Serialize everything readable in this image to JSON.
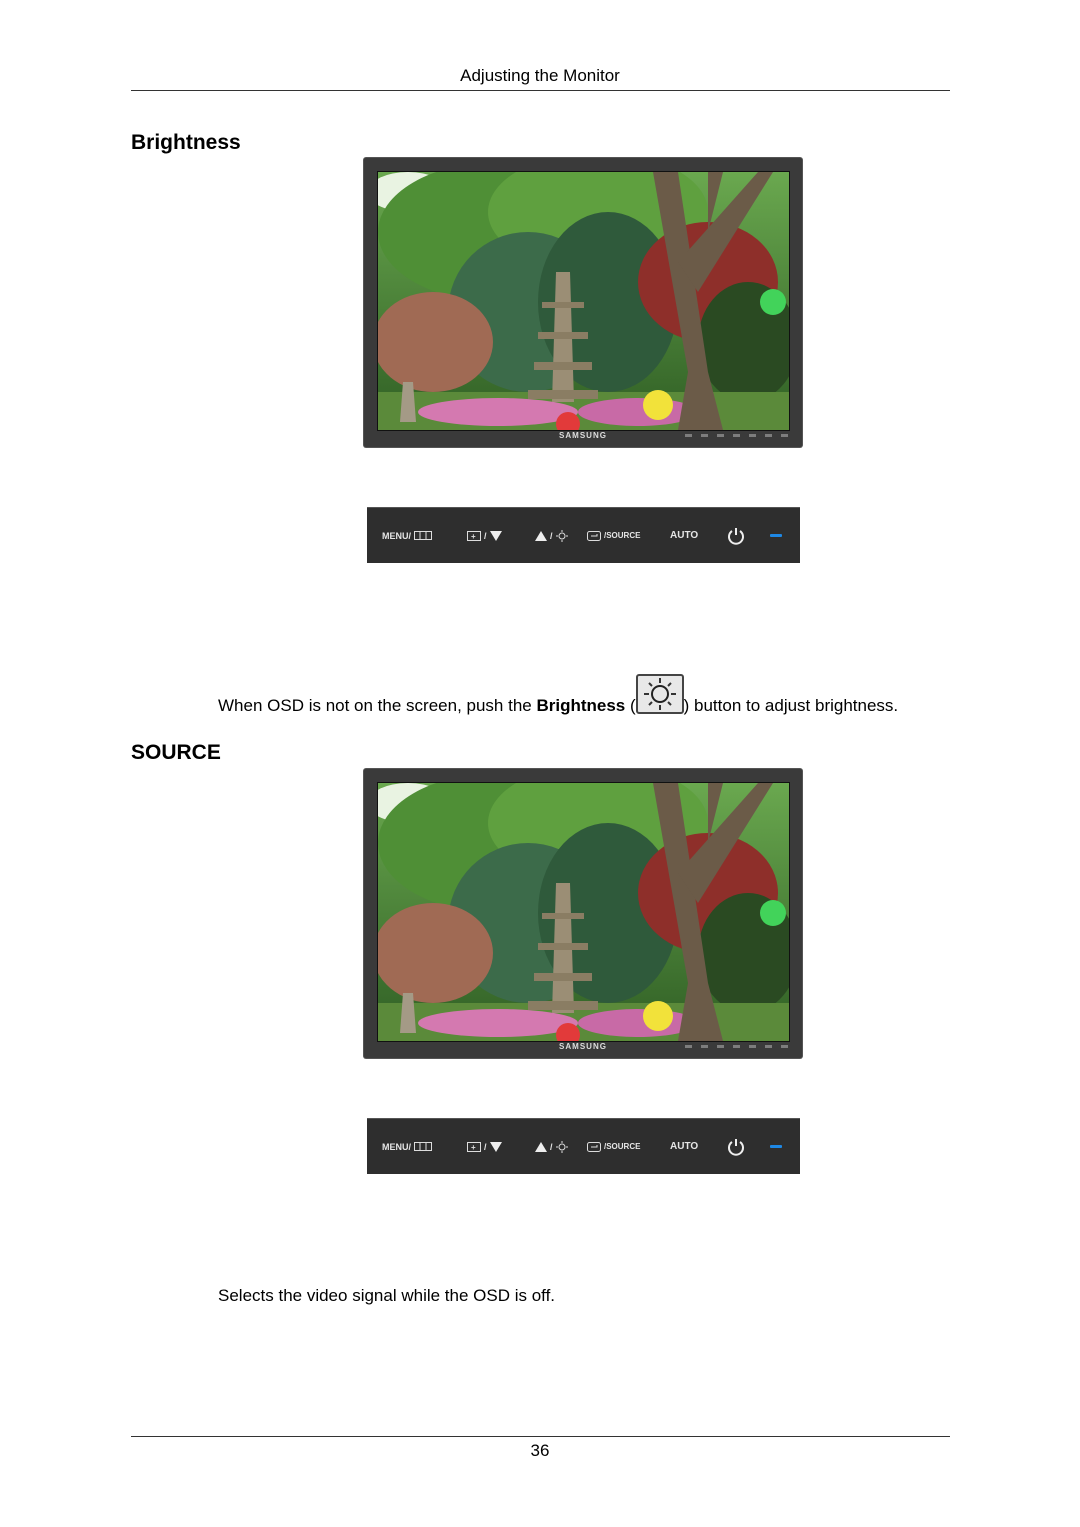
{
  "header": {
    "title": "Adjusting the Monitor"
  },
  "sections": [
    {
      "heading": "Brightness",
      "monitor": {
        "brand": "SAMSUNG",
        "image": "garden-with-stone-pagoda-and-lanterns"
      },
      "buttons": [
        {
          "label": "MENU/",
          "icon": "menu-grid-icon"
        },
        {
          "label": "/",
          "icon": "input-down-arrow-icon"
        },
        {
          "label": "/",
          "icon": "up-arrow-brightness-icon"
        },
        {
          "label": "/SOURCE",
          "icon": "enter-source-icon"
        },
        {
          "label": "AUTO"
        },
        {
          "icon": "power-icon"
        },
        {
          "icon": "power-led-icon",
          "color": "#1e88e5"
        }
      ],
      "description": {
        "prefix": "When OSD is not on the screen, push the ",
        "bold": "Brightness",
        "open_paren": " (",
        "icon": "brightness-sun-icon",
        "suffix": ") button to adjust brightness."
      }
    },
    {
      "heading": "SOURCE",
      "monitor": {
        "brand": "SAMSUNG",
        "image": "garden-with-stone-pagoda-and-lanterns"
      },
      "buttons": [
        {
          "label": "MENU/",
          "icon": "menu-grid-icon"
        },
        {
          "label": "/",
          "icon": "input-down-arrow-icon"
        },
        {
          "label": "/",
          "icon": "up-arrow-brightness-icon"
        },
        {
          "label": "/SOURCE",
          "icon": "enter-source-icon"
        },
        {
          "label": "AUTO"
        },
        {
          "icon": "power-icon"
        },
        {
          "icon": "power-led-icon",
          "color": "#1e88e5"
        }
      ],
      "description": {
        "text": "Selects the video signal while the OSD is off."
      }
    }
  ],
  "footer": {
    "page_number": "36"
  }
}
